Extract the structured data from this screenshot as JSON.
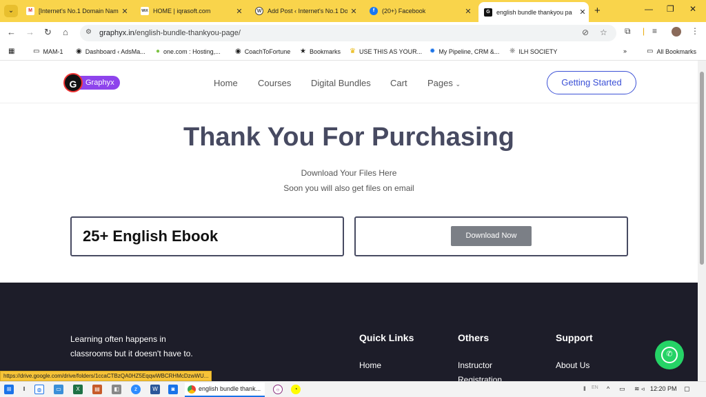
{
  "browser": {
    "tabs": [
      {
        "title": "[Internet's No.1 Domain Nam",
        "icon": "gmail-icon",
        "color": "#d93025",
        "glyph": "M"
      },
      {
        "title": "HOME | iqrasoft.com",
        "icon": "wix-icon",
        "color": "#333333",
        "glyph": "WiX"
      },
      {
        "title": "Add Post ‹ Internet's No.1 Do",
        "icon": "wordpress-icon",
        "color": "#444444",
        "glyph": "W"
      },
      {
        "title": "(20+) Facebook",
        "icon": "facebook-icon",
        "color": "#1877f2",
        "glyph": "f"
      },
      {
        "title": "english bundle thankyou pa",
        "icon": "graphyx-icon",
        "color": "#111111",
        "glyph": "G"
      }
    ],
    "url_domain": "graphyx.in",
    "url_path": "/english-bundle-thankyou-page/",
    "bookmarks": [
      {
        "label": "MAM-1",
        "icon": "folder-icon"
      },
      {
        "label": "Dashboard ‹ AdsMa...",
        "icon": "globe-icon"
      },
      {
        "label": "one.com : Hosting,...",
        "icon": "onecom-icon"
      },
      {
        "label": "CoachToFortune",
        "icon": "globe-icon"
      },
      {
        "label": "Bookmarks",
        "icon": "star-icon"
      },
      {
        "label": "USE THIS AS YOUR...",
        "icon": "crown-icon"
      },
      {
        "label": "My Pipeline, CRM &...",
        "icon": "gear-icon"
      },
      {
        "label": "ILH SOCIETY",
        "icon": "flower-icon"
      }
    ],
    "all_bookmarks": "All Bookmarks"
  },
  "site": {
    "logo_text": "Graphyx",
    "nav": [
      "Home",
      "Courses",
      "Digital Bundles",
      "Cart",
      "Pages"
    ],
    "cta": "Getting Started",
    "title": "Thank You For Purchasing",
    "subtitle1": "Download Your Files Here",
    "subtitle2": "Soon you will also get files on email",
    "product": "25+ English Ebook",
    "download_label": "Download Now",
    "footer": {
      "tagline": "Learning often happens in classrooms but it doesn't have to.",
      "quick_links_title": "Quick Links",
      "quick_links": [
        "Home"
      ],
      "others_title": "Others",
      "others": [
        "Instructor",
        "Registration"
      ],
      "support_title": "Support",
      "support": [
        "About Us"
      ]
    }
  },
  "status_url": "https://drive.google.com/drive/folders/1ccaCTBzQA0HZ5EqqwWBCRHMcDzwWU...",
  "taskbar": {
    "active_window": "english bundle thank...",
    "lang": "EN",
    "time": "12:20 PM"
  }
}
